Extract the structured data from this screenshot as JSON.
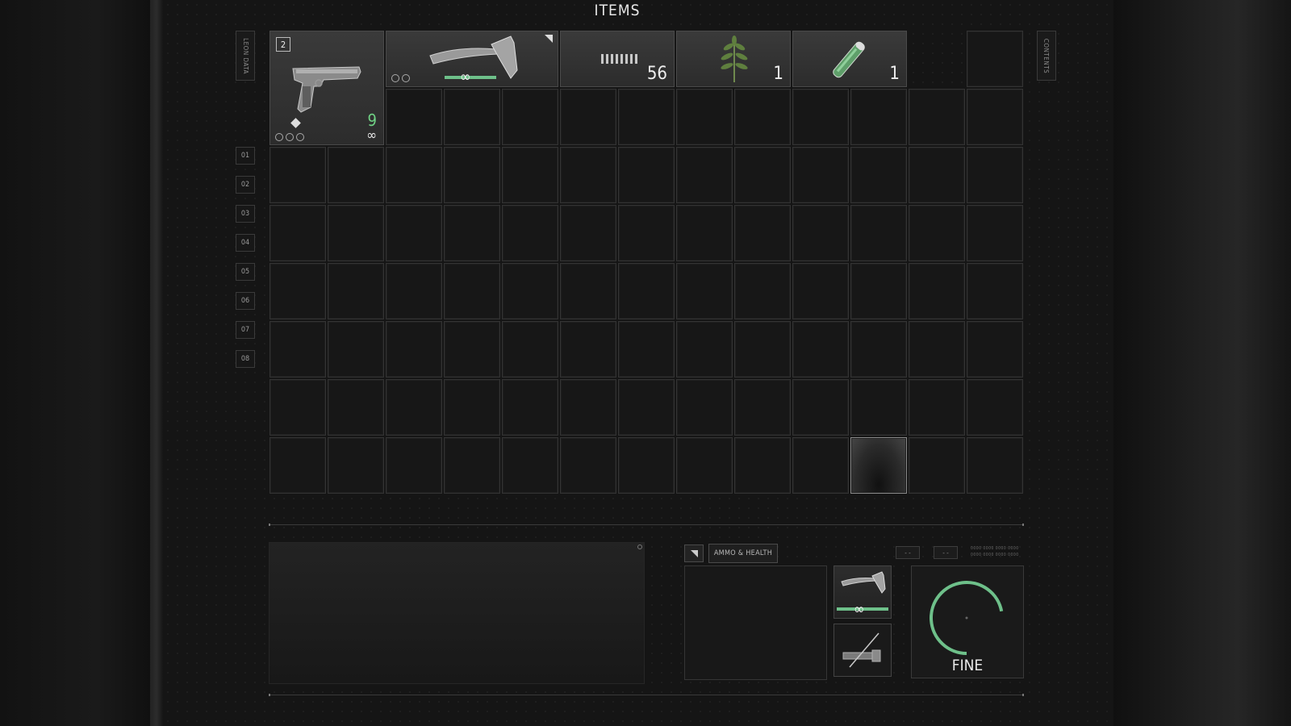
{
  "header": {
    "title": "ITEMS"
  },
  "tabs": {
    "left": "LEON DATA",
    "right": "CONTENTS"
  },
  "row_labels": [
    "01",
    "02",
    "03",
    "04",
    "05",
    "06",
    "07",
    "08"
  ],
  "items": {
    "pistol": {
      "badge": "2",
      "ammo": "9",
      "reserve": "∞"
    },
    "hatchet": {
      "durability": "∞"
    },
    "ammo": {
      "count": "56"
    },
    "herb": {
      "count": "1"
    },
    "spray": {
      "count": "1"
    }
  },
  "bottom": {
    "category": "AMMO & HEALTH",
    "mini_buttons": [
      "- -",
      "- -"
    ],
    "mini_text": [
      "0000 0000 0000 0000",
      "0000 0000 0000 0000"
    ],
    "equipped_durability": "∞",
    "health_status": "FINE",
    "health_level": 0.72
  },
  "colors": {
    "accent_green": "#6ec08a",
    "ammo_green": "#6fd184"
  }
}
